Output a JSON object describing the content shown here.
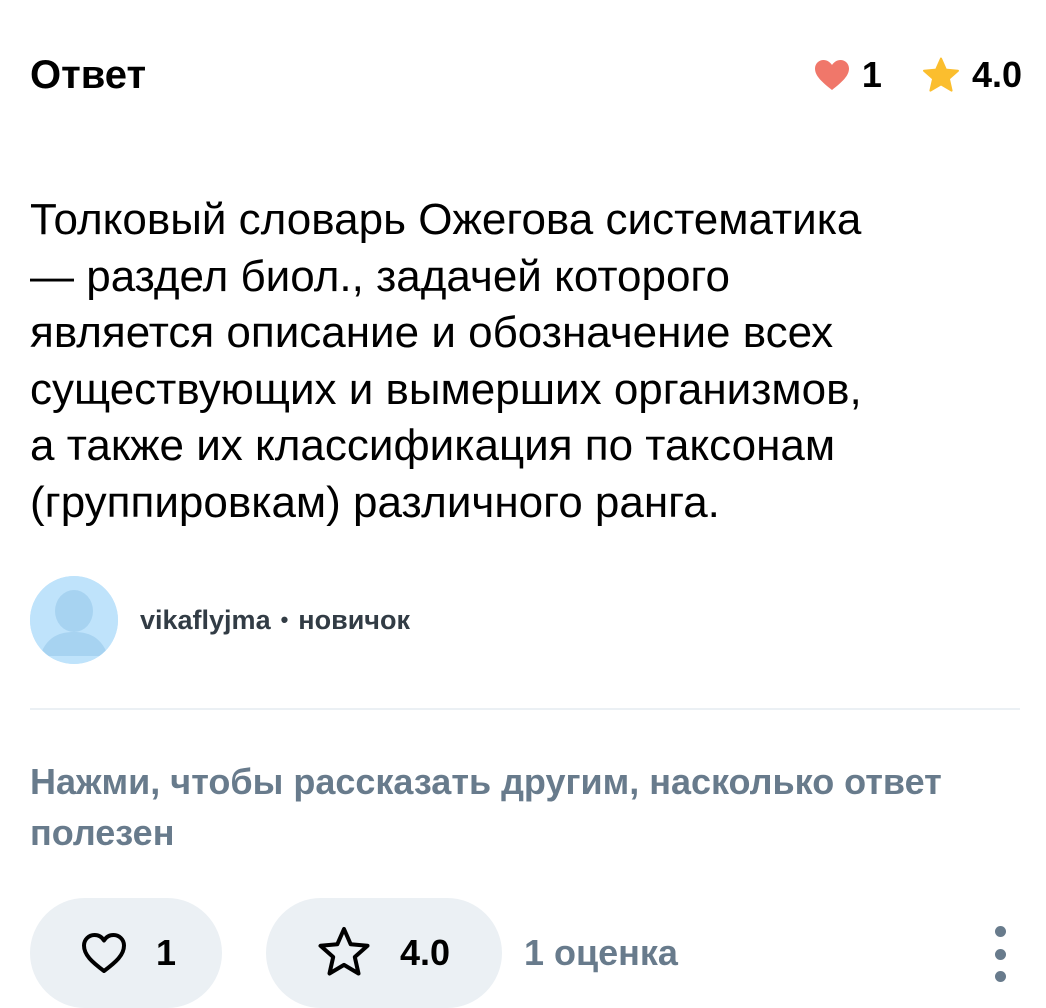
{
  "header": {
    "title": "Ответ",
    "likes": "1",
    "rating": "4.0"
  },
  "answer": {
    "lines": [
      "Толковый словарь Ожегова систематика",
      "— раздел биол., задачей которого",
      "является описание и обозначение всех",
      "существующих и вымерших организмов,",
      "а также их классификация по таксонам",
      "(группировкам) различного ранга."
    ]
  },
  "author": {
    "username": "vikaflyjma",
    "separator": "•",
    "rank": "новичок"
  },
  "feedback": {
    "prompt_line1": "Нажми, чтобы рассказать другим, насколько ответ",
    "prompt_line2": "полезен",
    "like_count": "1",
    "rating_value": "4.0",
    "rating_count": "1 оценка"
  },
  "icons": {
    "header_heart": "heart-icon",
    "header_star": "star-icon",
    "like_button": "heart-outline-icon",
    "rate_button": "star-outline-icon",
    "more": "more-vertical-icon"
  },
  "colors": {
    "heart": "#f0776a",
    "star": "#fbbe2e",
    "muted_text": "#687b8c",
    "pill_bg": "#ebf0f4",
    "avatar_bg": "#bfe3fb"
  }
}
